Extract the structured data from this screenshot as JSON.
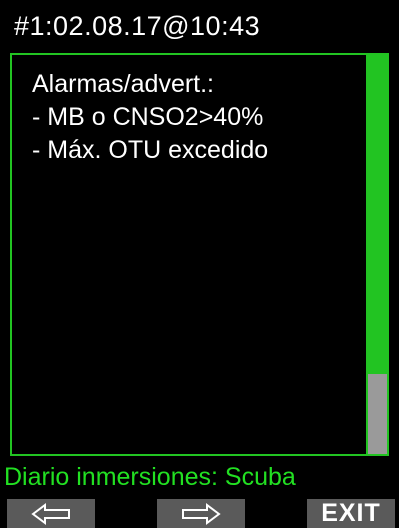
{
  "header": {
    "title": "#1:02.08.17@10:43"
  },
  "panel": {
    "lines": [
      "Alarmas/advert.:",
      "- MB o CNSO2>40%",
      "- Máx. OTU excedido"
    ],
    "scroll_position": 1.0
  },
  "status": {
    "text": "Diario inmersiones: Scuba"
  },
  "softkeys": {
    "left_icon": "arrow-left-icon",
    "middle_icon": "arrow-right-icon",
    "right_label": "EXIT"
  },
  "colors": {
    "accent_green": "#22c422",
    "status_green": "#22e022",
    "softkey_gray": "#5a5a5a",
    "scroll_thumb_gray": "#9a9a9a"
  }
}
